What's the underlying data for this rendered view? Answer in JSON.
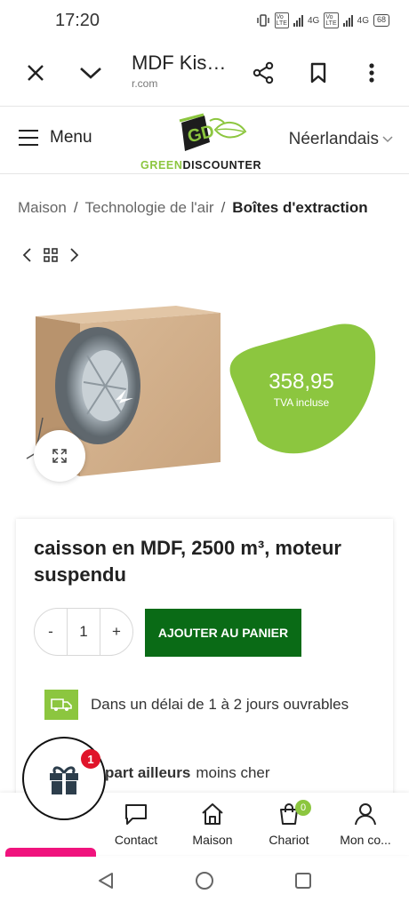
{
  "status_bar": {
    "time": "17:20",
    "net1": "4G",
    "net2": "4G",
    "net3": "4G",
    "lte": "LTE",
    "volte": "Vo",
    "battery": "68"
  },
  "browser": {
    "title": "MDF Kis…",
    "domain": "r.com"
  },
  "header": {
    "menu_label": "Menu",
    "logo_letters": "GD",
    "logo_word_green": "GREEN",
    "logo_word_dark": "DISCOUNTER",
    "language": "Néerlandais"
  },
  "breadcrumb": {
    "items": [
      "Maison",
      "Technologie de l'air"
    ],
    "current": "Boîtes d'extraction",
    "separator": "/"
  },
  "product": {
    "price": "358,95",
    "vat": "TVA incluse",
    "title": "caisson en MDF, 2500 m³, moteur suspendu",
    "qty_minus": "-",
    "qty_value": "1",
    "qty_plus": "+",
    "add_to_cart": "AJOUTER AU PANIER",
    "delivery": "Dans un délai de 1 à 2 jours ouvrables",
    "cheaper_bold": "part ailleurs",
    "cheaper_text": "moins cher"
  },
  "gift": {
    "badge": "1"
  },
  "bottom_nav": {
    "contact": "Contact",
    "home": "Maison",
    "cart": "Chariot",
    "cart_count": "0",
    "account": "Mon co..."
  },
  "colors": {
    "green": "#8cc63f",
    "dark_green": "#0a6b16",
    "pink": "#f0137d",
    "red_badge": "#e0142a"
  }
}
